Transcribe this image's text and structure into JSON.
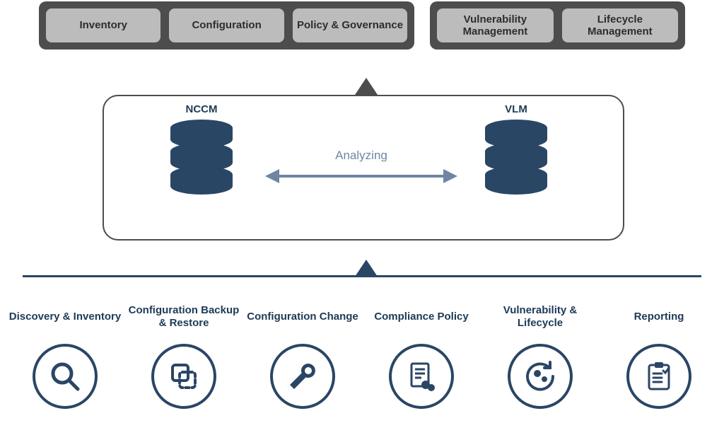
{
  "top": {
    "left_group": [
      "Inventory",
      "Configuration",
      "Policy & Governance"
    ],
    "right_group": [
      "Vulnerability Management",
      "Lifecycle Management"
    ]
  },
  "center": {
    "left_db": "NCCM",
    "right_db": "VLM",
    "relation": "Analyzing"
  },
  "bottom": [
    {
      "label": "Discovery & Inventory",
      "icon": "search"
    },
    {
      "label": "Configuration Backup & Restore",
      "icon": "copy"
    },
    {
      "label": "Configuration Change",
      "icon": "wrench"
    },
    {
      "label": "Compliance Policy",
      "icon": "policy"
    },
    {
      "label": "Vulnerability & Lifecycle",
      "icon": "cycle"
    },
    {
      "label": "Reporting",
      "icon": "report"
    }
  ],
  "colors": {
    "navy": "#2a4665",
    "dark_grey": "#4d4d4d",
    "light_grey": "#bcbcbc"
  }
}
